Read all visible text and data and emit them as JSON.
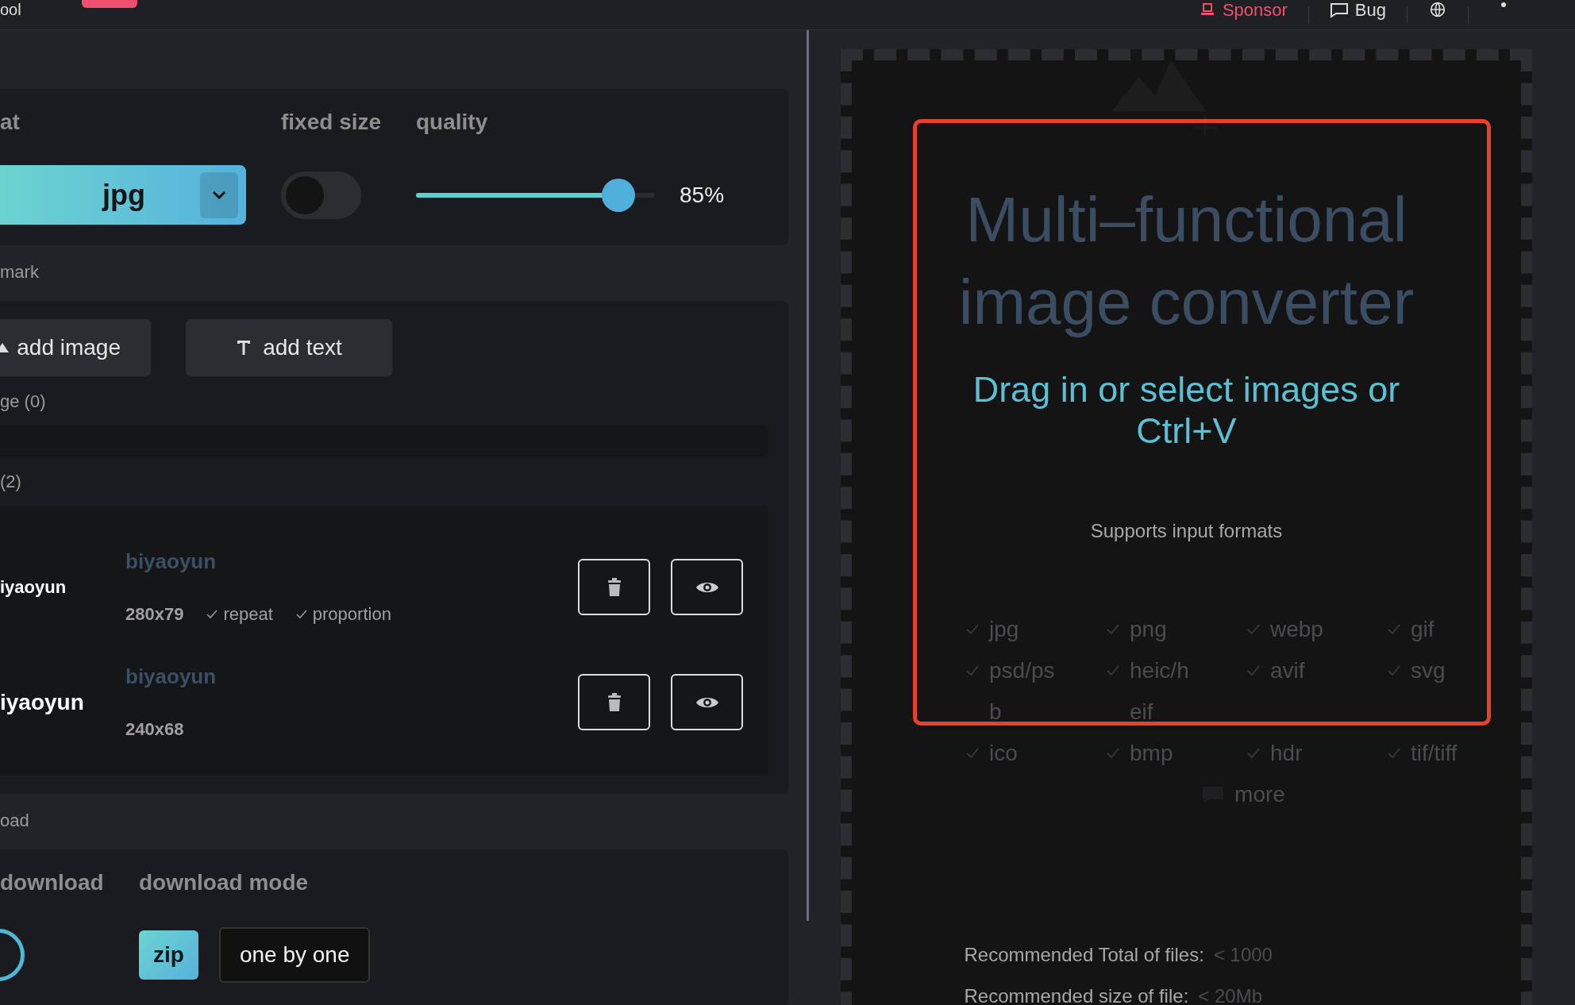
{
  "header": {
    "logo_text": "ool",
    "nav": [
      {
        "kind": "sponsor",
        "label": "Sponsor"
      },
      {
        "kind": "bug",
        "label": "Bug"
      },
      {
        "kind": "language"
      },
      {
        "kind": "more"
      }
    ]
  },
  "settings": {
    "format": {
      "label": "at",
      "value": "jpg"
    },
    "fixed_size": {
      "label": "fixed size",
      "on": false
    },
    "quality": {
      "label": "quality",
      "level": 0.85,
      "reading": "85%"
    }
  },
  "watermark": {
    "label": "mark",
    "buttons": [
      {
        "kind": "image",
        "label": "add image"
      },
      {
        "kind": "text",
        "label": "add text"
      }
    ],
    "image_group": {
      "label": "ge (0)"
    },
    "text_group": {
      "label": "(2)",
      "items": [
        {
          "preview": "iyaoyun",
          "name": "biyaoyun",
          "size": "280x79",
          "options": [
            {
              "label": "repeat",
              "checked": true
            },
            {
              "label": "proportion",
              "checked": true
            }
          ]
        },
        {
          "preview": "iyaoyun",
          "name": "biyaoyun",
          "size": "240x68"
        }
      ]
    }
  },
  "download": {
    "label": "oad",
    "columns": [
      "download",
      "download mode"
    ],
    "modes": [
      {
        "label": "zip",
        "selected": true
      },
      {
        "label": "one by one",
        "selected": false
      }
    ]
  },
  "dropzone": {
    "title": "Multi–functional image converter",
    "subtitle": "Drag in or select images or Ctrl+V",
    "formats_label": "Supports input formats",
    "format_rows": [
      [
        {
          "text": "jpg",
          "checked": true
        },
        {
          "text": "png",
          "checked": true
        },
        {
          "text": "webp",
          "checked": true
        },
        {
          "text": "gif",
          "checked": true
        }
      ],
      [
        {
          "text": "psd/ps",
          "checked": true
        },
        {
          "text": "heic/h",
          "checked": true
        },
        {
          "text": "avif",
          "checked": true
        },
        {
          "text": "svg",
          "checked": true
        }
      ],
      [
        {
          "text": "b",
          "checked": false
        },
        {
          "text": "eif",
          "checked": false
        }
      ],
      [
        {
          "text": "ico",
          "checked": true
        },
        {
          "text": "bmp",
          "checked": true
        },
        {
          "text": "hdr",
          "checked": true
        },
        {
          "text": "tif/tiff",
          "checked": true
        }
      ]
    ],
    "more": "more",
    "limits": [
      {
        "label": "Recommended Total of files:",
        "value": "< 1000"
      },
      {
        "label": "Recommended size of file:",
        "value": "< 20Mb"
      }
    ]
  }
}
